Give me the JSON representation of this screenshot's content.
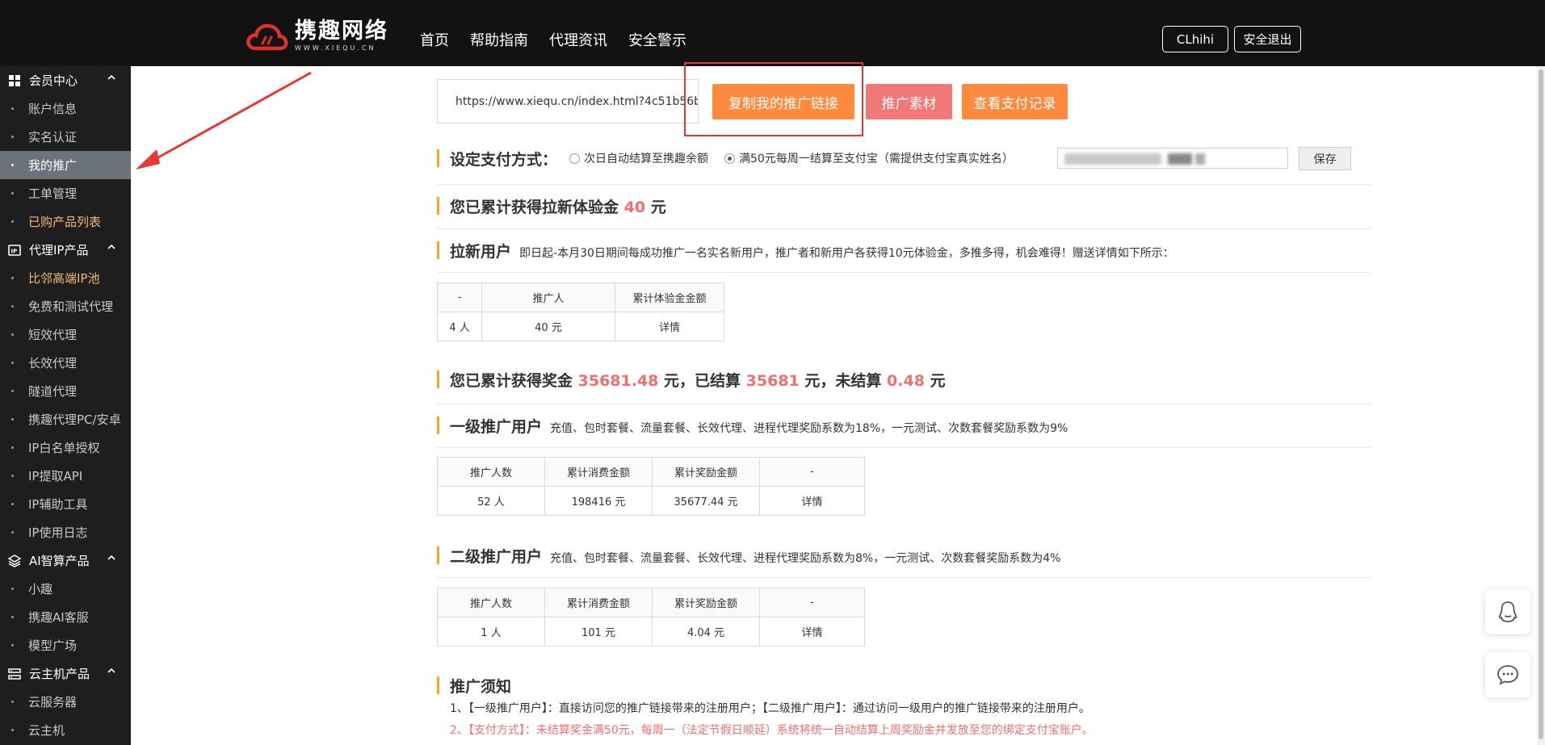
{
  "header": {
    "logo": {
      "name": "携趣网络",
      "sub": "WWW.XIEQU.CN"
    },
    "nav": [
      "首页",
      "帮助指南",
      "代理资讯",
      "安全警示"
    ],
    "user": "CLhihi",
    "logout": "安全退出"
  },
  "sidebar": {
    "groups": [
      {
        "label": "会员中心",
        "icon": "grid-icon",
        "items": [
          {
            "label": "账户信息"
          },
          {
            "label": "实名认证"
          },
          {
            "label": "我的推广",
            "active": true
          },
          {
            "label": "工单管理"
          },
          {
            "label": "已购产品列表",
            "highlight": true
          }
        ]
      },
      {
        "label": "代理IP产品",
        "icon": "ip-icon",
        "items": [
          {
            "label": "比邻高端IP池",
            "highlight": true
          },
          {
            "label": "免费和测试代理"
          },
          {
            "label": "短效代理"
          },
          {
            "label": "长效代理"
          },
          {
            "label": "隧道代理"
          },
          {
            "label": "携趣代理PC/安卓"
          },
          {
            "label": "IP白名单授权"
          },
          {
            "label": "IP提取API"
          },
          {
            "label": "IP辅助工具"
          },
          {
            "label": "IP使用日志"
          }
        ]
      },
      {
        "label": "AI智算产品",
        "icon": "layers-icon",
        "items": [
          {
            "label": "小趣"
          },
          {
            "label": "携趣AI客服"
          },
          {
            "label": "模型广场"
          }
        ]
      },
      {
        "label": "云主机产品",
        "icon": "server-icon",
        "items": [
          {
            "label": "云服务器"
          },
          {
            "label": "云主机"
          }
        ]
      }
    ]
  },
  "promo": {
    "link": "https://www.xiequ.cn/index.html?4c51b56b",
    "copy_btn": "复制我的推广链接",
    "material_btn": "推广素材",
    "records_btn": "查看支付记录"
  },
  "payment": {
    "title": "设定支付方式：",
    "option1": "次日自动结算至携趣余额",
    "option2": "满50元每周一结算至支付宝（需提供支付宝真实姓名）",
    "save": "保存"
  },
  "newuser": {
    "total_prefix": "您已累计获得拉新体验金",
    "total_value": "40",
    "total_unit": "元",
    "title": "拉新用户",
    "desc": "即日起-本月30日期间每成功推广一名实名新用户，推广者和新用户各获得10元体验金，多推多得，机会难得！赠送详情如下所示：",
    "table": {
      "headers": [
        "-",
        "推广人",
        "累计体验金金额"
      ],
      "row": [
        "4 人",
        "40 元",
        "详情"
      ]
    }
  },
  "bonus": {
    "prefix": "您已累计获得奖金",
    "total": "35681.48",
    "mid1": "元，已结算",
    "settled": "35681",
    "mid2": "元，未结算",
    "unsettled": "0.48",
    "unit": "元"
  },
  "level1": {
    "title": "一级推广用户",
    "desc": "充值、包时套餐、流量套餐、长效代理、进程代理奖励系数为18%，一元测试、次数套餐奖励系数为9%",
    "table": {
      "headers": [
        "推广人数",
        "累计消费金额",
        "累计奖励金额",
        "-"
      ],
      "row": [
        "52 人",
        "198416 元",
        "35677.44 元",
        "详情"
      ]
    }
  },
  "level2": {
    "title": "二级推广用户",
    "desc": "充值、包时套餐、流量套餐、长效代理、进程代理奖励系数为8%，一元测试、次数套餐奖励系数为4%",
    "table": {
      "headers": [
        "推广人数",
        "累计消费金额",
        "累计奖励金额",
        "-"
      ],
      "row": [
        "1 人",
        "101 元",
        "4.04 元",
        "详情"
      ]
    }
  },
  "notice": {
    "title": "推广须知",
    "line1": "1、【一级推广用户】：直接访问您的推广链接带来的注册用户；【二级推广用户】：通过访问一级用户的推广链接带来的注册用户。",
    "line2": "2、【支付方式】：未结算奖金满50元，每周一（法定节假日顺延）系统将统一自动结算上周奖励金并发放至您的绑定支付宝账户。"
  },
  "colors": {
    "orange": "#ff8a3d",
    "pink": "#f27777",
    "accent_text": "#f0706e",
    "gold": "#f5a623"
  }
}
